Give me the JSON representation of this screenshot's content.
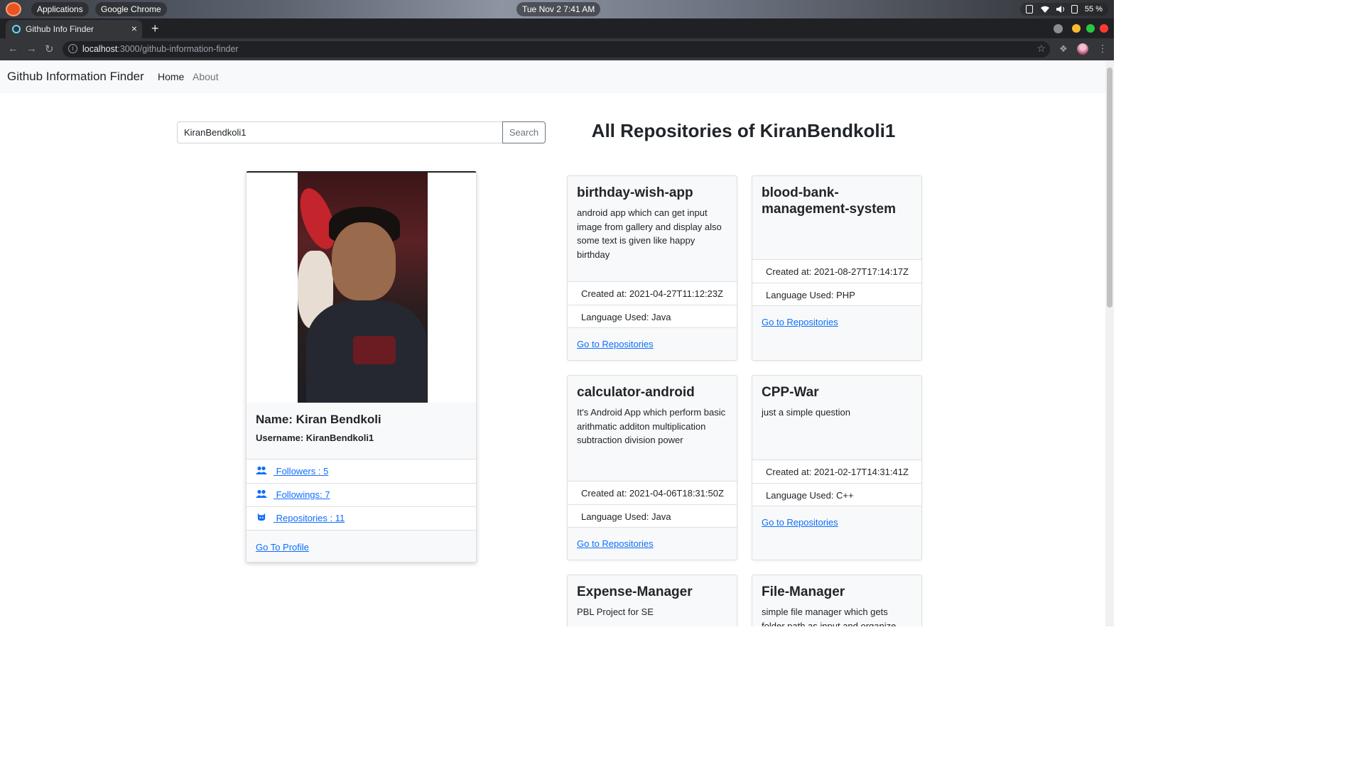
{
  "desktop": {
    "applications_label": "Applications",
    "active_app": "Google Chrome",
    "clock": "Tue Nov 2   7:41 AM",
    "battery": "55 %"
  },
  "browser": {
    "tab_title": "Github Info Finder",
    "tab_close": "×",
    "new_tab": "+",
    "url_host": "localhost",
    "url_rest": ":3000/github-information-finder",
    "colors": {
      "close": "#ff5f57",
      "max": "#28c840",
      "min": "#febc2e"
    }
  },
  "navbar": {
    "brand": "Github Information Finder",
    "links": [
      "Home",
      "About"
    ]
  },
  "search": {
    "value": "KiranBendkoli1",
    "button": "Search"
  },
  "heading": "All Repositories of KiranBendkoli1",
  "profile": {
    "name": "Name: Kiran Bendkoli",
    "username": "Username: KiranBendkoli1",
    "followers": "Followers : 5",
    "followings": "Followings: 7",
    "repositories": "Repositories : 11",
    "go_to_profile": "Go To Profile"
  },
  "repos": [
    {
      "title": "birthday-wish-app",
      "description": "android app which can get input image from gallery and display also some text is given like happy birthday",
      "created": "Created at: 2021-04-27T11:12:23Z",
      "language": "Language Used: Java",
      "link": "Go to Repositories"
    },
    {
      "title": "blood-bank-management-system",
      "description": "",
      "created": "Created at: 2021-08-27T17:14:17Z",
      "language": "Language Used: PHP",
      "link": "Go to Repositories"
    },
    {
      "title": "calculator-android",
      "description": "It's Android App which perform basic arithmatic additon multiplication subtraction division power",
      "created": "Created at: 2021-04-06T18:31:50Z",
      "language": "Language Used: Java",
      "link": "Go to Repositories"
    },
    {
      "title": "CPP-War",
      "description": "just a simple question",
      "created": "Created at: 2021-02-17T14:31:41Z",
      "language": "Language Used: C++",
      "link": "Go to Repositories"
    },
    {
      "title": "Expense-Manager",
      "description": "PBL Project for SE"
    },
    {
      "title": "File-Manager",
      "description": "simple file manager which gets folder path as input and organize"
    }
  ]
}
